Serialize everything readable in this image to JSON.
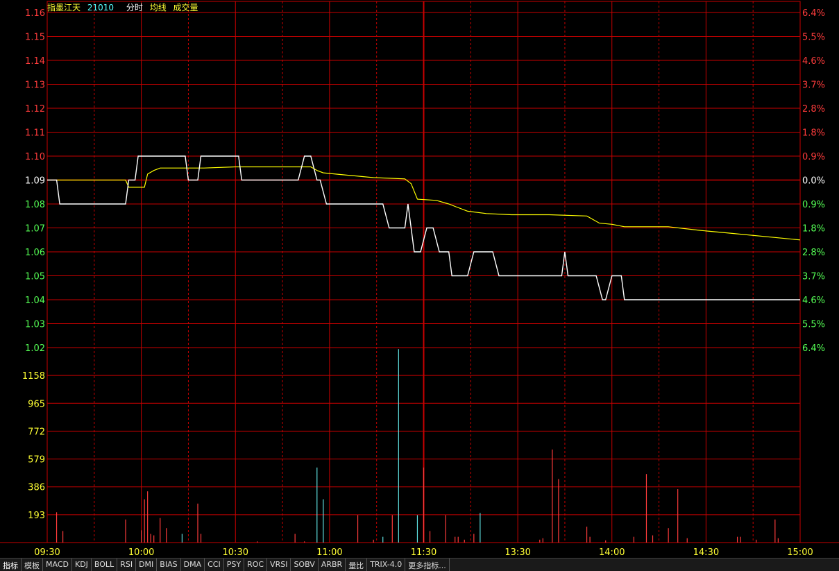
{
  "header": {
    "name": "指墨江天",
    "code": "21010",
    "labels": [
      "分时",
      "均线",
      "成交量"
    ]
  },
  "colors": {
    "up": "#ff3c3c",
    "down": "#55ff55",
    "flat": "#ffffff",
    "volume_axis": "#ffff33",
    "grid": "#c80000",
    "price_line": "#ffffff",
    "avg_line": "#ffff00",
    "vol_up": "#ff3c3c",
    "vol_down": "#5fe0e0"
  },
  "chart_data": {
    "type": "line",
    "prev_close": 1.09,
    "price_ticks": [
      "1.16",
      "1.15",
      "1.14",
      "1.13",
      "1.12",
      "1.11",
      "1.10",
      "1.09",
      "1.08",
      "1.07",
      "1.06",
      "1.05",
      "1.04",
      "1.03",
      "1.02"
    ],
    "pct_ticks": [
      "6.4%",
      "5.5%",
      "4.6%",
      "3.7%",
      "2.8%",
      "1.8%",
      "0.9%",
      "0.0%",
      "0.9%",
      "1.8%",
      "2.8%",
      "3.7%",
      "4.6%",
      "5.5%",
      "6.4%"
    ],
    "volume_ticks": [
      "1158",
      "965",
      "772",
      "579",
      "386",
      "193"
    ],
    "time_ticks": [
      "09:30",
      "10:00",
      "10:30",
      "11:00",
      "11:30",
      "13:30",
      "14:00",
      "14:30",
      "15:00"
    ],
    "ylim": [
      1.02,
      1.16
    ],
    "volume_max": 1351,
    "price": [
      [
        0,
        1.09
      ],
      [
        3,
        1.09
      ],
      [
        4,
        1.08
      ],
      [
        25,
        1.08
      ],
      [
        26,
        1.09
      ],
      [
        28,
        1.09
      ],
      [
        29,
        1.1
      ],
      [
        44,
        1.1
      ],
      [
        45,
        1.09
      ],
      [
        48,
        1.09
      ],
      [
        49,
        1.1
      ],
      [
        61,
        1.1
      ],
      [
        62,
        1.09
      ],
      [
        80,
        1.09
      ],
      [
        82,
        1.1
      ],
      [
        84,
        1.1
      ],
      [
        86,
        1.09
      ],
      [
        87,
        1.09
      ],
      [
        89,
        1.08
      ],
      [
        107,
        1.08
      ],
      [
        109,
        1.07
      ],
      [
        114,
        1.07
      ],
      [
        115,
        1.08
      ],
      [
        117,
        1.06
      ],
      [
        119,
        1.06
      ],
      [
        121,
        1.07
      ],
      [
        123,
        1.07
      ],
      [
        125,
        1.06
      ],
      [
        128,
        1.06
      ],
      [
        129,
        1.05
      ],
      [
        134,
        1.05
      ],
      [
        136,
        1.06
      ],
      [
        142,
        1.06
      ],
      [
        144,
        1.05
      ],
      [
        164,
        1.05
      ],
      [
        165,
        1.06
      ],
      [
        166,
        1.05
      ],
      [
        175,
        1.05
      ],
      [
        177,
        1.04
      ],
      [
        178,
        1.04
      ],
      [
        180,
        1.05
      ],
      [
        183,
        1.05
      ],
      [
        184,
        1.04
      ],
      [
        240,
        1.04
      ]
    ],
    "avg": [
      [
        0,
        1.09
      ],
      [
        25,
        1.09
      ],
      [
        26,
        1.087
      ],
      [
        31,
        1.087
      ],
      [
        32,
        1.0925
      ],
      [
        34,
        1.094
      ],
      [
        36,
        1.095
      ],
      [
        50,
        1.095
      ],
      [
        60,
        1.0955
      ],
      [
        84,
        1.0955
      ],
      [
        86,
        1.094
      ],
      [
        88,
        1.093
      ],
      [
        96,
        1.092
      ],
      [
        104,
        1.091
      ],
      [
        114,
        1.0905
      ],
      [
        116,
        1.0885
      ],
      [
        118,
        1.082
      ],
      [
        124,
        1.0815
      ],
      [
        128,
        1.08
      ],
      [
        130,
        1.079
      ],
      [
        134,
        1.077
      ],
      [
        140,
        1.076
      ],
      [
        148,
        1.0755
      ],
      [
        160,
        1.0755
      ],
      [
        172,
        1.075
      ],
      [
        176,
        1.072
      ],
      [
        180,
        1.0715
      ],
      [
        184,
        1.0705
      ],
      [
        198,
        1.0705
      ],
      [
        208,
        1.069
      ],
      [
        216,
        1.068
      ],
      [
        240,
        1.065
      ]
    ],
    "volume": [
      [
        3,
        210,
        "up"
      ],
      [
        5,
        80,
        "up"
      ],
      [
        25,
        160,
        "up"
      ],
      [
        30,
        85,
        "up"
      ],
      [
        31,
        300,
        "up"
      ],
      [
        32,
        355,
        "up"
      ],
      [
        33,
        60,
        "up"
      ],
      [
        34,
        50,
        "up"
      ],
      [
        36,
        170,
        "up"
      ],
      [
        38,
        100,
        "up"
      ],
      [
        43,
        60,
        "down"
      ],
      [
        48,
        270,
        "up"
      ],
      [
        49,
        60,
        "up"
      ],
      [
        67,
        8,
        "up"
      ],
      [
        79,
        60,
        "up"
      ],
      [
        82,
        8,
        "up"
      ],
      [
        86,
        520,
        "down"
      ],
      [
        88,
        300,
        "down"
      ],
      [
        99,
        190,
        "up"
      ],
      [
        104,
        20,
        "up"
      ],
      [
        107,
        40,
        "down"
      ],
      [
        110,
        190,
        "up"
      ],
      [
        112,
        1340,
        "down"
      ],
      [
        118,
        190,
        "down"
      ],
      [
        120,
        520,
        "up"
      ],
      [
        122,
        80,
        "up"
      ],
      [
        127,
        190,
        "up"
      ],
      [
        130,
        40,
        "up"
      ],
      [
        131,
        40,
        "up"
      ],
      [
        133,
        20,
        "up"
      ],
      [
        136,
        60,
        "up"
      ],
      [
        138,
        205,
        "down"
      ],
      [
        157,
        20,
        "up"
      ],
      [
        158,
        30,
        "up"
      ],
      [
        161,
        645,
        "up"
      ],
      [
        163,
        440,
        "up"
      ],
      [
        172,
        110,
        "up"
      ],
      [
        173,
        40,
        "up"
      ],
      [
        178,
        15,
        "up"
      ],
      [
        187,
        40,
        "up"
      ],
      [
        191,
        475,
        "up"
      ],
      [
        193,
        50,
        "up"
      ],
      [
        198,
        100,
        "up"
      ],
      [
        201,
        370,
        "up"
      ],
      [
        204,
        30,
        "up"
      ],
      [
        220,
        40,
        "up"
      ],
      [
        221,
        40,
        "up"
      ],
      [
        226,
        20,
        "up"
      ],
      [
        232,
        160,
        "up"
      ],
      [
        233,
        30,
        "up"
      ]
    ]
  },
  "tabs": [
    "指标",
    "模板",
    "MACD",
    "KDJ",
    "BOLL",
    "RSI",
    "DMI",
    "BIAS",
    "DMA",
    "CCI",
    "PSY",
    "ROC",
    "VRSI",
    "SOBV",
    "ARBR",
    "量比",
    "TRIX-4.0",
    "更多指标..."
  ]
}
